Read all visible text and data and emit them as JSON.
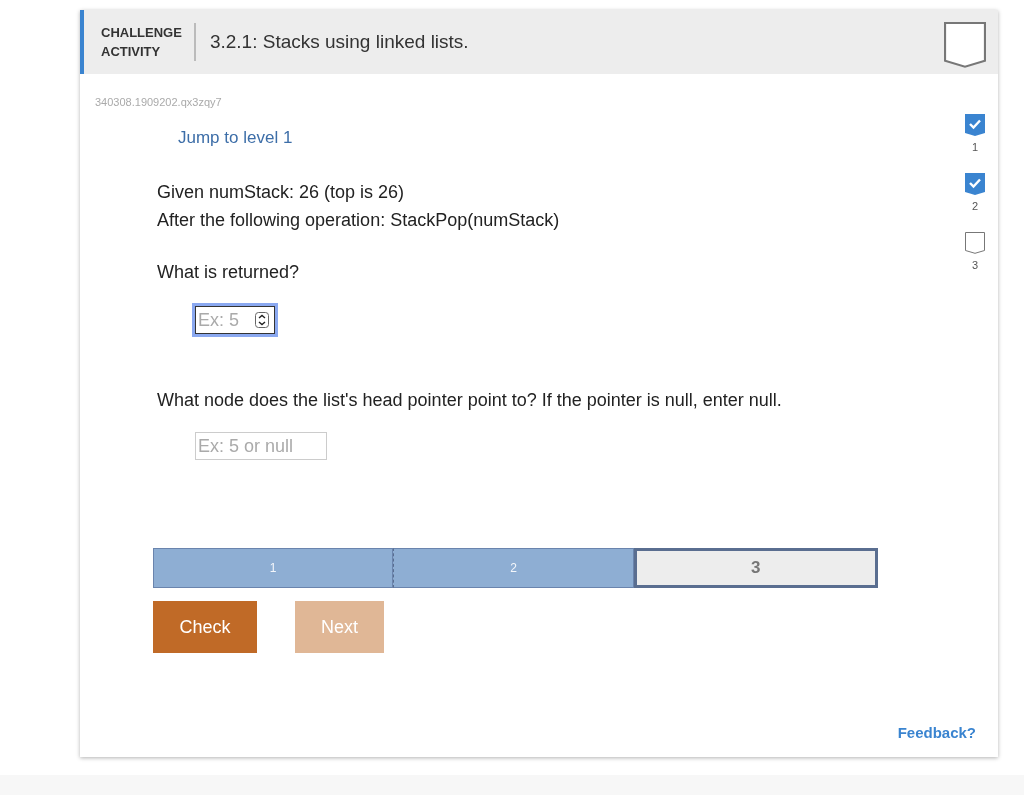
{
  "header": {
    "kind_label": "CHALLENGE\nACTIVITY",
    "title": "3.2.1: Stacks using linked lists.",
    "completed": false
  },
  "activity_id": "340308.1909202.qx3zqy7",
  "jump_link": "Jump to level 1",
  "level_markers": [
    {
      "label": "1",
      "checked": true
    },
    {
      "label": "2",
      "checked": true
    },
    {
      "label": "3",
      "checked": false
    }
  ],
  "prompt": [
    "Given numStack: 26 (top is 26)",
    "After the following operation: StackPop(numStack)"
  ],
  "questions": [
    {
      "text": "What is returned?",
      "placeholder": "Ex: 5",
      "kind": "number",
      "focused": true
    },
    {
      "text": "What node does the list's head pointer point to? If the pointer is null, enter null.",
      "placeholder": "Ex: 5 or null",
      "kind": "text",
      "focused": false
    }
  ],
  "progress": [
    {
      "label": "1",
      "done": true,
      "selected": false
    },
    {
      "label": "2",
      "done": true,
      "selected": false
    },
    {
      "label": "3",
      "done": false,
      "selected": true
    }
  ],
  "buttons": [
    {
      "label": "Check",
      "disabled": false
    },
    {
      "label": "Next",
      "disabled": true
    }
  ],
  "feedback_link": "Feedback?"
}
